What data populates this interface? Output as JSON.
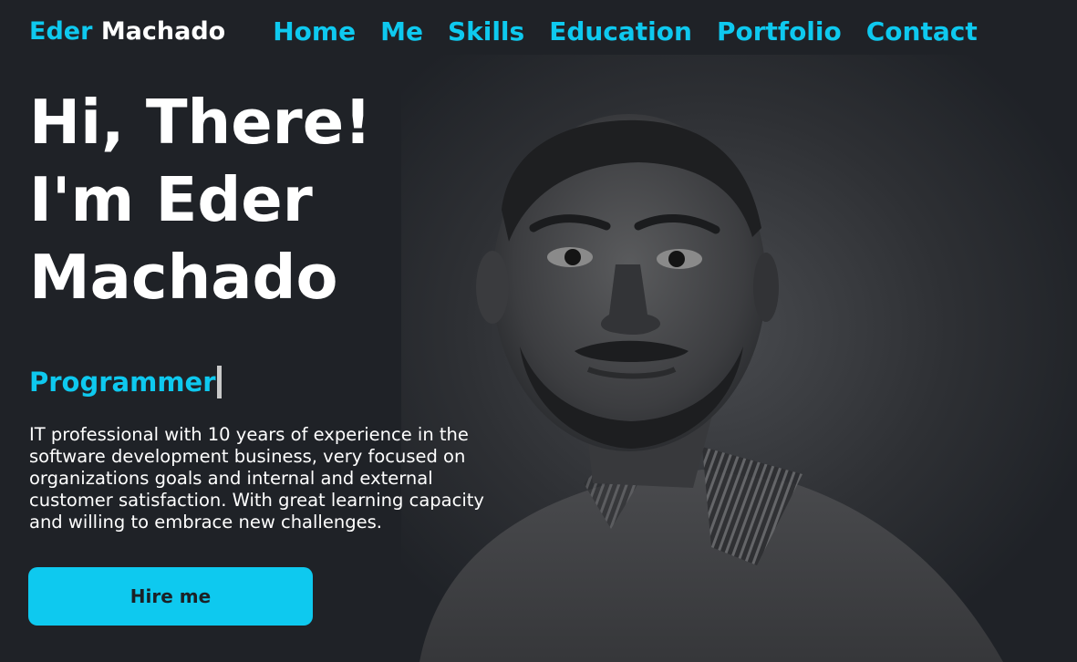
{
  "header": {
    "logo_first": "Eder",
    "logo_last": "Machado",
    "nav": [
      {
        "label": "Home"
      },
      {
        "label": "Me"
      },
      {
        "label": "Skills"
      },
      {
        "label": "Education"
      },
      {
        "label": "Portfolio"
      },
      {
        "label": "Contact"
      }
    ]
  },
  "hero": {
    "greeting_line1": "Hi, There!",
    "greeting_line2": "I'm Eder",
    "greeting_line3": "Machado",
    "role": "Programmer",
    "about": "IT professional with 10 years of experience in the software development business, very focused on organizations goals and internal and external customer satisfaction. With great learning capacity and willing to embrace new challenges.",
    "cta_label": "Hire me"
  },
  "colors": {
    "background": "#1f2227",
    "accent": "#0ec9ef",
    "text": "#ffffff"
  }
}
